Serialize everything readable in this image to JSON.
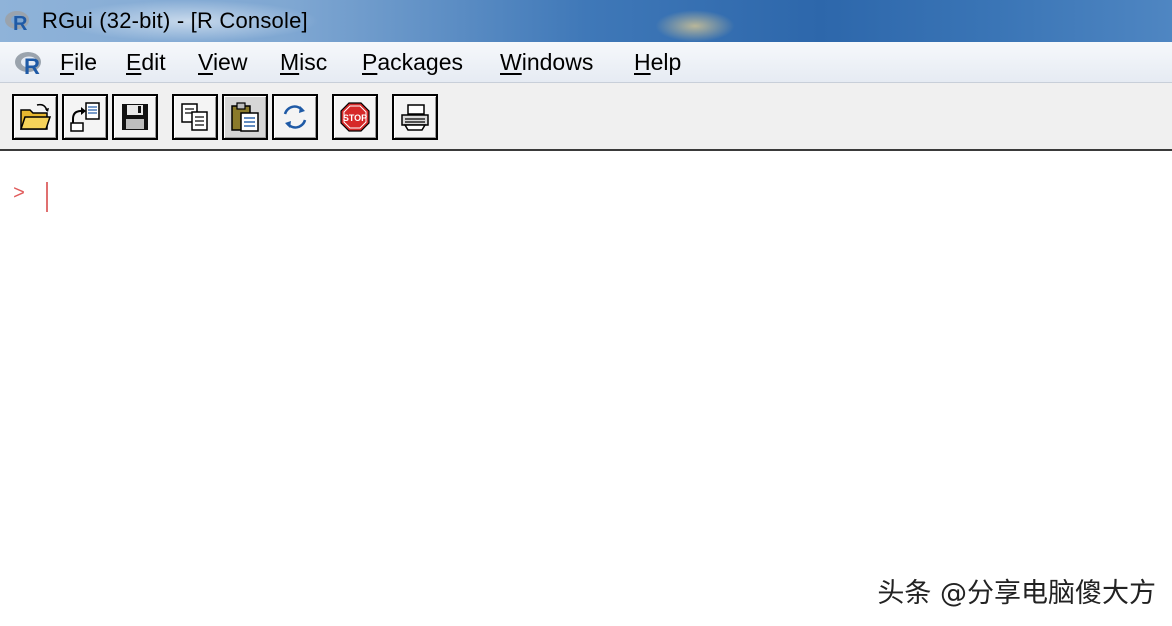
{
  "window": {
    "title": "RGui (32-bit) - [R Console]",
    "app_icon": "r-logo-icon"
  },
  "menu": {
    "items": [
      {
        "accel": "F",
        "rest": "ile"
      },
      {
        "accel": "E",
        "rest": "dit"
      },
      {
        "accel": "V",
        "rest": "iew"
      },
      {
        "accel": "M",
        "rest": "isc"
      },
      {
        "accel": "P",
        "rest": "ackages"
      },
      {
        "accel": "W",
        "rest": "indows"
      },
      {
        "accel": "H",
        "rest": "elp"
      }
    ]
  },
  "toolbar": {
    "buttons": [
      {
        "icon": "open-folder-icon"
      },
      {
        "icon": "load-workspace-icon"
      },
      {
        "icon": "save-icon"
      },
      {
        "icon": "copy-icon"
      },
      {
        "icon": "paste-icon",
        "pressed": true
      },
      {
        "icon": "copy-paste-icon"
      },
      {
        "icon": "stop-icon",
        "label": "STOP"
      },
      {
        "icon": "print-icon"
      }
    ]
  },
  "console": {
    "prompt": ">"
  },
  "watermark": {
    "text": "头条 @分享电脑傻大方"
  },
  "colors": {
    "prompt": "#e05a5a",
    "stop_red": "#d62828",
    "titlebar_blue": "#2d67ab"
  }
}
